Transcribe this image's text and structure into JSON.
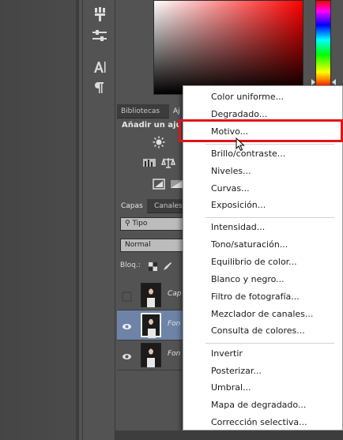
{
  "panels": {
    "adjustments": {
      "tabs": [
        "Bibliotecas",
        "Aj"
      ],
      "title": "Añadir un aju"
    },
    "layers": {
      "tabs": [
        "Capas",
        "Canales"
      ],
      "filter_label": "Tipo",
      "blend_mode": "Normal",
      "lock_label": "Bloq.:",
      "layers": [
        {
          "name": "Cap"
        },
        {
          "name": "Fon"
        },
        {
          "name": "Fon"
        }
      ]
    }
  },
  "menu": {
    "items_group1": [
      "Color uniforme...",
      "Degradado...",
      "Motivo..."
    ],
    "items_group2": [
      "Brillo/contraste...",
      "Niveles...",
      "Curvas...",
      "Exposición..."
    ],
    "items_group3": [
      "Intensidad...",
      "Tono/saturación...",
      "Equilibrio de color...",
      "Blanco y negro...",
      "Filtro de fotografía...",
      "Mezclador de canales...",
      "Consulta de colores..."
    ],
    "items_group4": [
      "Invertir",
      "Posterizar...",
      "Umbral...",
      "Mapa de degradado...",
      "Corrección selectiva..."
    ],
    "highlighted_item": "Motivo..."
  },
  "colors": {
    "highlight_border": "#e0141c",
    "selected_layer": "#6d84a8",
    "menu_bg": "#ffffff"
  }
}
